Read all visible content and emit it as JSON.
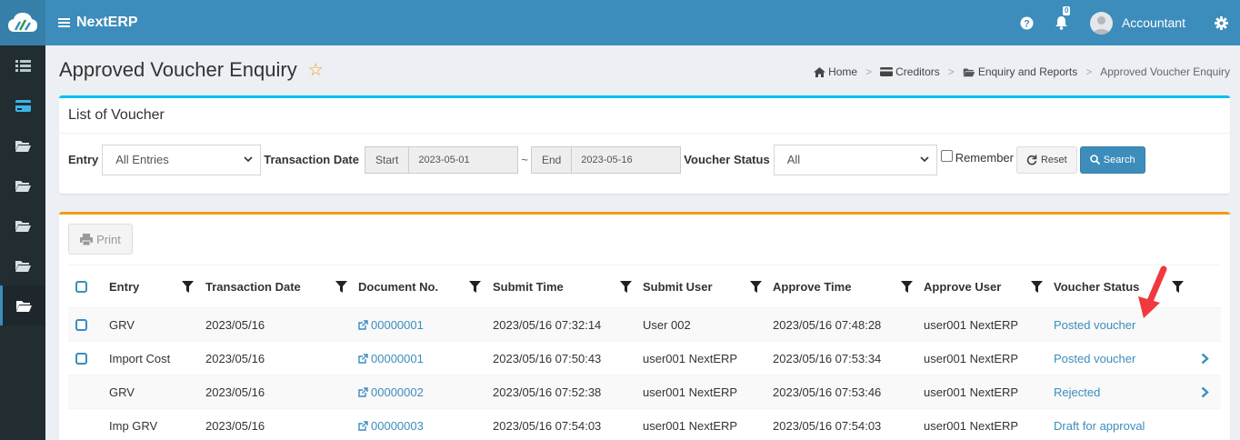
{
  "app": {
    "brand": "NextERP",
    "notif_count": "0",
    "user_name": "Accountant"
  },
  "page": {
    "title": "Approved Voucher Enquiry"
  },
  "breadcrumb": [
    "Home",
    "Creditors",
    "Enquiry and Reports",
    "Approved Voucher Enquiry"
  ],
  "filters": {
    "box_title": "List of Voucher",
    "entry_label": "Entry",
    "entry_value": "All Entries",
    "date_label": "Transaction Date",
    "start_label": "Start",
    "start_value": "2023-05-01",
    "sep": "~",
    "end_label": "End",
    "end_value": "2023-05-16",
    "status_label": "Voucher Status",
    "status_value": "All",
    "remember_label": "Remember",
    "reset_label": "Reset",
    "search_label": "Search"
  },
  "toolbar": {
    "print_label": "Print"
  },
  "table": {
    "headers": [
      "Entry",
      "Transaction Date",
      "Document No.",
      "Submit Time",
      "Submit User",
      "Approve Time",
      "Approve User",
      "Voucher Status"
    ],
    "rows": [
      {
        "entry": "GRV",
        "date": "2023/05/16",
        "doc": "00000001",
        "submit_time": "2023/05/16 07:32:14",
        "submit_user": "User 002",
        "approve_time": "2023/05/16 07:48:28",
        "approve_user": "user001 NextERP",
        "status": "Posted voucher"
      },
      {
        "entry": "Import Cost",
        "date": "2023/05/16",
        "doc": "00000001",
        "submit_time": "2023/05/16 07:50:43",
        "submit_user": "user001 NextERP",
        "approve_time": "2023/05/16 07:53:34",
        "approve_user": "user001 NextERP",
        "status": "Posted voucher"
      },
      {
        "entry": "GRV",
        "date": "2023/05/16",
        "doc": "00000002",
        "submit_time": "2023/05/16 07:52:38",
        "submit_user": "user001 NextERP",
        "approve_time": "2023/05/16 07:53:46",
        "approve_user": "user001 NextERP",
        "status": "Rejected"
      },
      {
        "entry": "Imp GRV",
        "date": "2023/05/16",
        "doc": "00000003",
        "submit_time": "2023/05/16 07:54:03",
        "submit_user": "user001 NextERP",
        "approve_time": "2023/05/16 07:54:03",
        "approve_user": "user001 NextERP",
        "status": "Draft for approval"
      }
    ]
  },
  "colors": {
    "header_bg": "#3c8dbc",
    "sidebar_bg": "#222d32",
    "link": "#3c8dbc",
    "star": "#f39c12",
    "annotation_arrow": "#f0393f"
  }
}
